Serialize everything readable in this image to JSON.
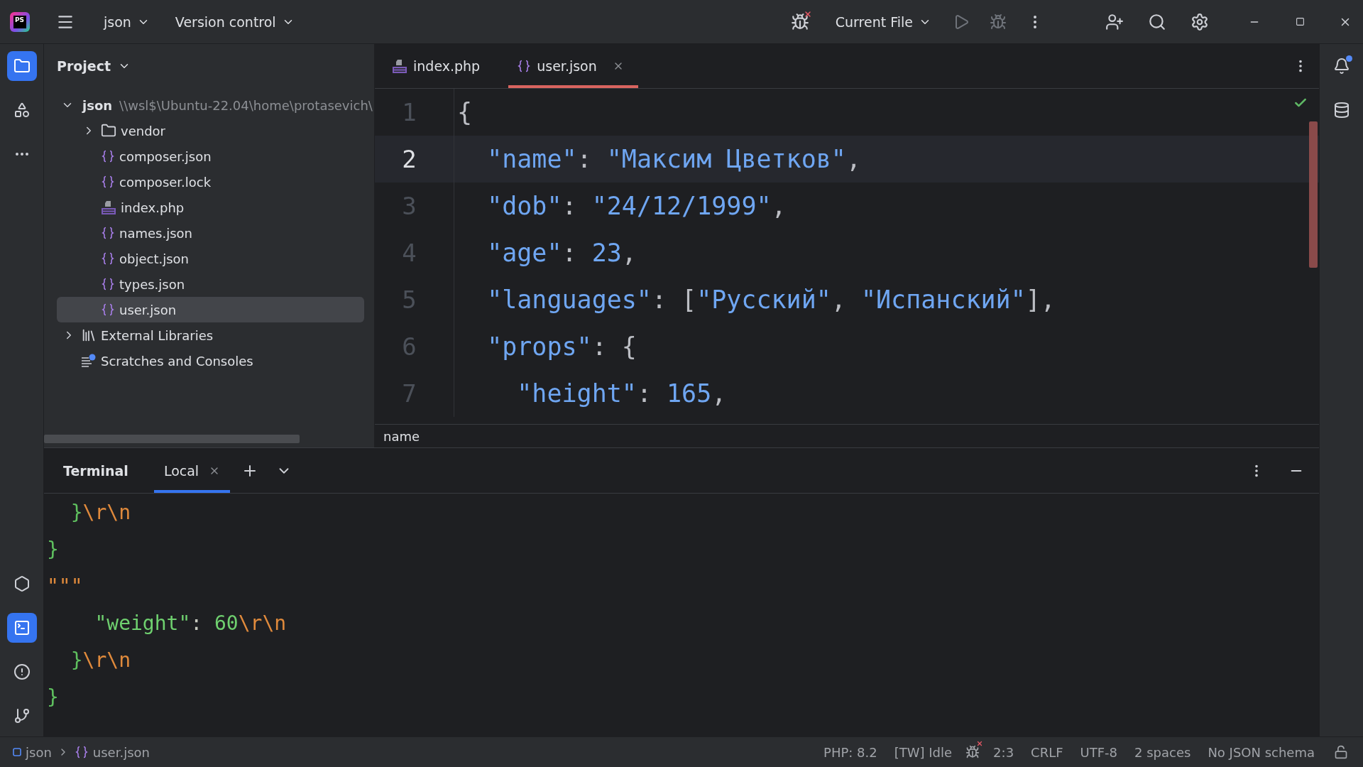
{
  "title_bar": {
    "logo": "PS",
    "project": "json",
    "vcs": "Version control",
    "run_config": "Current File"
  },
  "tool_stripe_top": [
    {
      "kind": "project",
      "selected": true
    },
    {
      "kind": "structure",
      "selected": false
    },
    {
      "kind": "more",
      "selected": false
    }
  ],
  "tool_stripe_bottom": [
    {
      "kind": "services",
      "selected": false
    },
    {
      "kind": "terminal",
      "selected": true
    },
    {
      "kind": "problems",
      "selected": false
    },
    {
      "kind": "git",
      "selected": false
    }
  ],
  "project_panel": {
    "title": "Project",
    "tree": [
      {
        "label": "json",
        "path": "\\\\wsl$\\Ubuntu-22.04\\home\\protasevich\\",
        "kind": "folder",
        "expanded": true,
        "selected": false,
        "children": [
          {
            "label": "vendor",
            "kind": "folder",
            "expanded": false,
            "selected": false
          },
          {
            "label": "composer.json",
            "kind": "json",
            "selected": false
          },
          {
            "label": "composer.lock",
            "kind": "json",
            "selected": false
          },
          {
            "label": "index.php",
            "kind": "php",
            "selected": false
          },
          {
            "label": "names.json",
            "kind": "json",
            "selected": false
          },
          {
            "label": "object.json",
            "kind": "json",
            "selected": false
          },
          {
            "label": "types.json",
            "kind": "json",
            "selected": false
          },
          {
            "label": "user.json",
            "kind": "json",
            "selected": true
          }
        ]
      },
      {
        "label": "External Libraries",
        "kind": "libraries",
        "expanded": false,
        "selected": false
      },
      {
        "label": "Scratches and Consoles",
        "kind": "scratches",
        "selected": false
      }
    ]
  },
  "editor": {
    "tabs": [
      {
        "label": "index.php",
        "kind": "php",
        "selected": false
      },
      {
        "label": "user.json",
        "kind": "json",
        "selected": true
      }
    ],
    "lines": [
      {
        "number": "1",
        "current": false,
        "tokens": [
          {
            "kind": "punct",
            "text": "{"
          }
        ]
      },
      {
        "number": "2",
        "current": true,
        "tokens": [
          {
            "kind": "key",
            "text": "  \"name\""
          },
          {
            "kind": "punct",
            "text": ": "
          },
          {
            "kind": "string",
            "text": "\"Максим Цветков\""
          },
          {
            "kind": "punct",
            "text": ","
          }
        ]
      },
      {
        "number": "3",
        "current": false,
        "tokens": [
          {
            "kind": "key",
            "text": "  \"dob\""
          },
          {
            "kind": "punct",
            "text": ": "
          },
          {
            "kind": "string",
            "text": "\"24/12/1999\""
          },
          {
            "kind": "punct",
            "text": ","
          }
        ]
      },
      {
        "number": "4",
        "current": false,
        "tokens": [
          {
            "kind": "key",
            "text": "  \"age\""
          },
          {
            "kind": "punct",
            "text": ": "
          },
          {
            "kind": "number",
            "text": "23"
          },
          {
            "kind": "punct",
            "text": ","
          }
        ]
      },
      {
        "number": "5",
        "current": false,
        "tokens": [
          {
            "kind": "key",
            "text": "  \"languages\""
          },
          {
            "kind": "punct",
            "text": ": ["
          },
          {
            "kind": "string",
            "text": "\"Русский\""
          },
          {
            "kind": "punct",
            "text": ", "
          },
          {
            "kind": "string",
            "text": "\"Испанский\""
          },
          {
            "kind": "punct",
            "text": "],"
          }
        ]
      },
      {
        "number": "6",
        "current": false,
        "tokens": [
          {
            "kind": "key",
            "text": "  \"props\""
          },
          {
            "kind": "punct",
            "text": ": {"
          }
        ]
      },
      {
        "number": "7",
        "current": false,
        "tokens": [
          {
            "kind": "key",
            "text": "    \"height\""
          },
          {
            "kind": "punct",
            "text": ": "
          },
          {
            "kind": "number",
            "text": "165"
          },
          {
            "kind": "punct",
            "text": ","
          }
        ]
      }
    ],
    "breadcrumb": "name"
  },
  "terminal": {
    "title": "Terminal",
    "tabs": [
      {
        "label": "Local",
        "selected": true
      }
    ],
    "lines": [
      [
        {
          "kind": "brace",
          "text": "  }"
        },
        {
          "kind": "escape",
          "text": "\\r\\n"
        }
      ],
      [
        {
          "kind": "brace",
          "text": "}"
        }
      ],
      [
        {
          "kind": "quote",
          "text": "\"\"\""
        }
      ],
      [
        {
          "kind": "key",
          "text": "    \"weight\""
        },
        {
          "kind": "punct",
          "text": ": "
        },
        {
          "kind": "number",
          "text": "60"
        },
        {
          "kind": "escape",
          "text": "\\r\\n"
        }
      ],
      [
        {
          "kind": "brace",
          "text": "  }"
        },
        {
          "kind": "escape",
          "text": "\\r\\n"
        }
      ],
      [
        {
          "kind": "brace",
          "text": "}"
        }
      ]
    ]
  },
  "status_bar": {
    "path": [
      {
        "label": "json",
        "kind": "module"
      },
      {
        "label": "user.json",
        "kind": "json"
      }
    ],
    "items": [
      {
        "kind": "text",
        "label": "PHP: 8.2"
      },
      {
        "kind": "text",
        "label": "[TW] Idle"
      },
      {
        "kind": "bug"
      },
      {
        "kind": "text",
        "label": "2:3"
      },
      {
        "kind": "text",
        "label": "CRLF"
      },
      {
        "kind": "text",
        "label": "UTF-8"
      },
      {
        "kind": "text",
        "label": "2 spaces"
      },
      {
        "kind": "text",
        "label": "No JSON schema"
      },
      {
        "kind": "lock"
      }
    ]
  }
}
